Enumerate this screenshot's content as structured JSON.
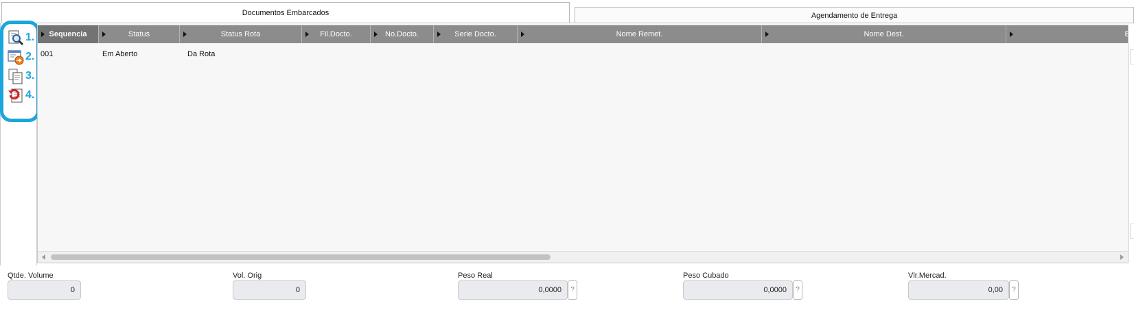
{
  "tabs": [
    {
      "label": "Documentos Embarcados"
    },
    {
      "label": "Agendamento de Entrega"
    }
  ],
  "toolbar": {
    "items": [
      {
        "number": "1.",
        "icon": "document-magnifier-icon"
      },
      {
        "number": "2.",
        "icon": "document-export-icon"
      },
      {
        "number": "3.",
        "icon": "copy-documents-icon"
      },
      {
        "number": "4.",
        "icon": "document-undo-icon"
      }
    ],
    "callout_color": "#1aa6dd"
  },
  "grid": {
    "columns": [
      "Sequencia",
      "Status",
      "Status Rota",
      "Fil.Docto.",
      "No.Docto.",
      "Serie Docto.",
      "Nome Remet.",
      "Nome Dest.",
      "Ba"
    ],
    "rows": [
      {
        "sequencia": "001",
        "status": "Em Aberto",
        "status_rota": "Da Rota"
      }
    ],
    "header_color": "#8c8c8c"
  },
  "footer": {
    "qtde_volume": {
      "label": "Qtde. Volume",
      "value": "0"
    },
    "vol_orig": {
      "label": "Vol. Orig",
      "value": "0"
    },
    "peso_real": {
      "label": "Peso Real",
      "value": "0,0000"
    },
    "peso_cubado": {
      "label": "Peso Cubado",
      "value": "0,0000"
    },
    "vlr_mercad": {
      "label": "Vlr.Mercad.",
      "value": "0,00"
    },
    "help_label": "?"
  }
}
